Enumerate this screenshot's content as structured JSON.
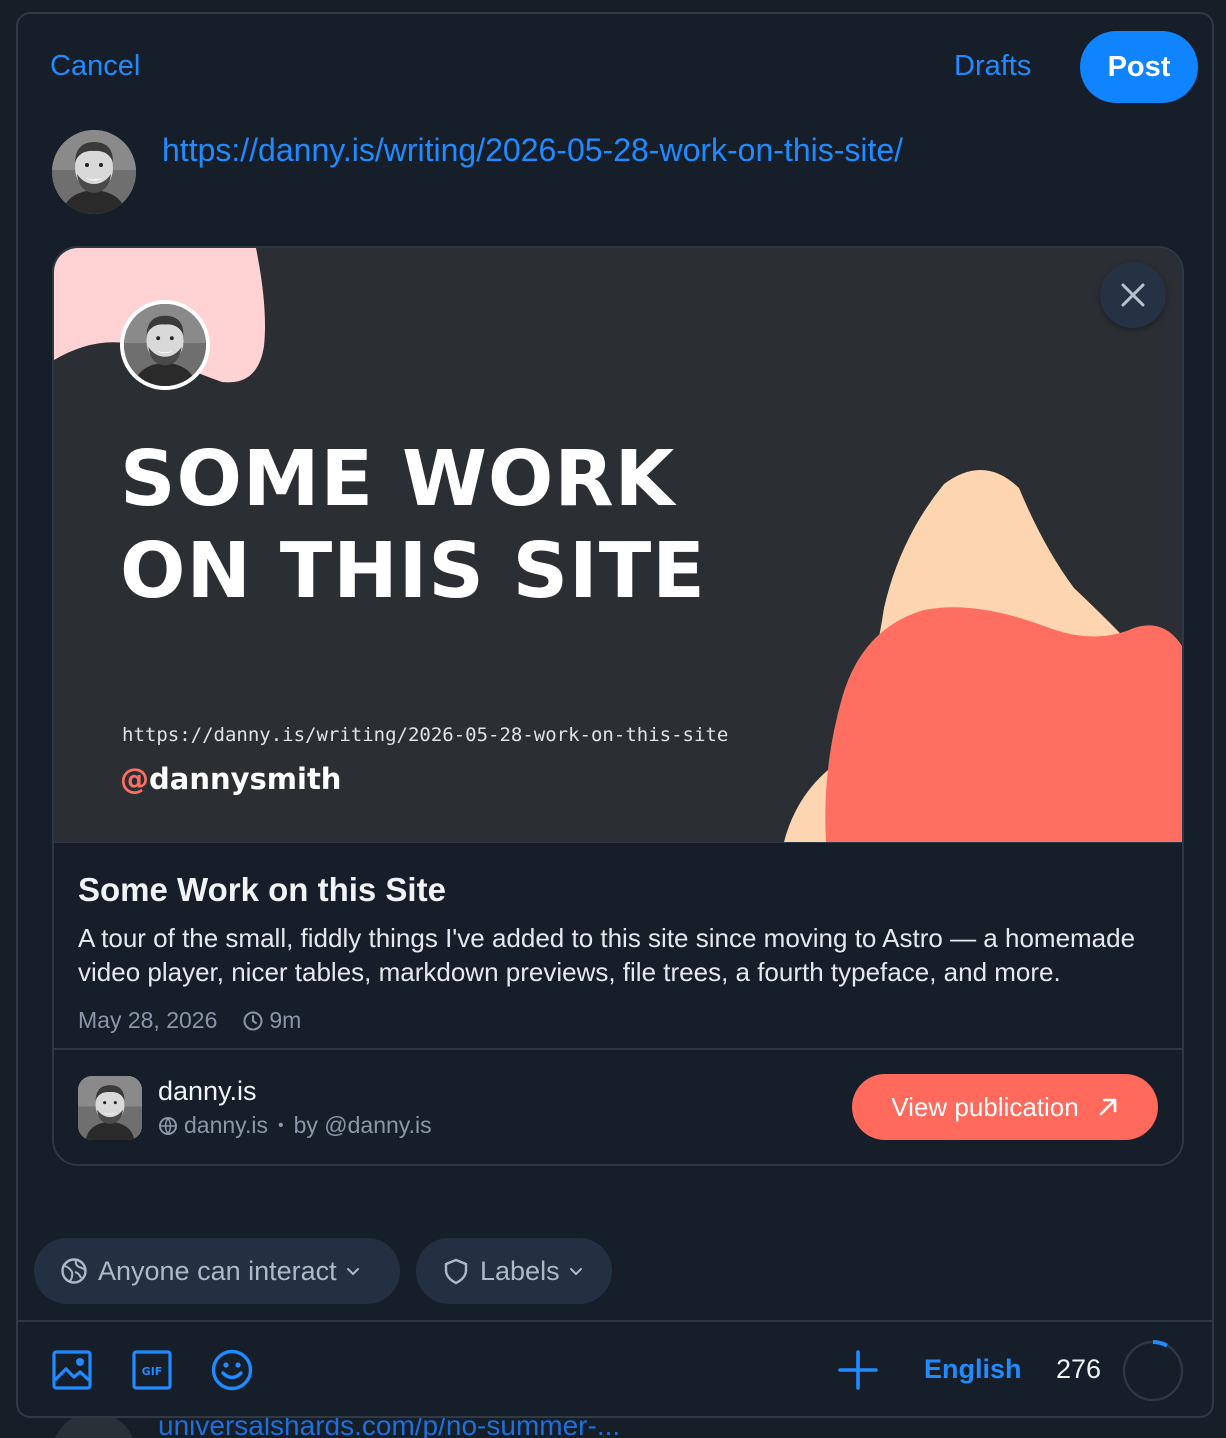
{
  "header": {
    "cancel_label": "Cancel",
    "drafts_label": "Drafts",
    "post_label": "Post"
  },
  "composer": {
    "text": "https://danny.is/writing/2026-05-28-work-on-this-site/"
  },
  "link_card": {
    "image": {
      "headline_line1": "SOME WORK",
      "headline_line2": "ON THIS SITE",
      "url": "https://danny.is/writing/2026-05-28-work-on-this-site",
      "handle_at": "@",
      "handle_name": "dannysmith"
    },
    "title": "Some Work on this Site",
    "description": "A tour of the small, fiddly things I've added to this site since moving to Astro — a homemade video player, nicer tables, markdown previews, file trees, a fourth typeface, and more.",
    "date": "May 28, 2026",
    "read_time": "9m",
    "publication": {
      "name": "danny.is",
      "domain": "danny.is",
      "separator": "•",
      "by": "by @danny.is",
      "view_label": "View publication"
    }
  },
  "settings": {
    "interaction_label": "Anyone can interact",
    "labels_label": "Labels"
  },
  "toolbar": {
    "language_label": "English",
    "remaining_chars": "276",
    "used_fraction": 0.08
  },
  "background_post": {
    "link_text": "universalshards.com/p/no-summer-..."
  },
  "colors": {
    "accent": "#208bfe",
    "post_button": "#1083fe",
    "view_publication_button": "#ff6a5d",
    "panel": "#161e2a"
  },
  "icons": {
    "close": "close-icon",
    "clock": "clock-icon",
    "globe": "globe-icon",
    "arrow": "arrow-up-right-icon",
    "interaction": "interaction-icon",
    "shield": "shield-icon",
    "chevron": "chevron-down-icon",
    "image": "image-icon",
    "gif": "gif-icon",
    "emoji": "emoji-icon",
    "add_thread": "plus-icon"
  }
}
